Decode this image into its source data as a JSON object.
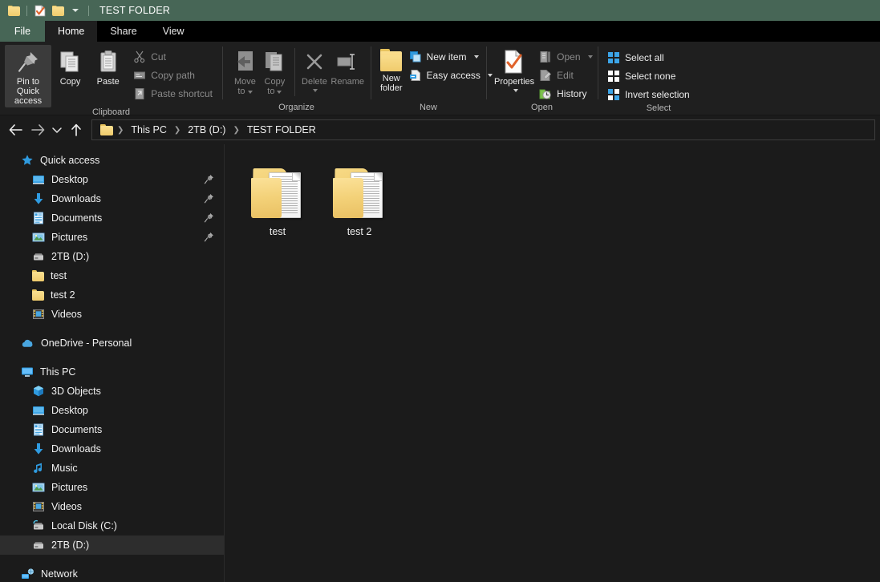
{
  "window": {
    "title": "TEST FOLDER",
    "titlebar_color": "#476656",
    "background_color": "#1b1b1b"
  },
  "quick_access_toolbar": [
    {
      "icon": "folder-icon",
      "name": "properties-folder-icon"
    },
    {
      "icon": "properties-icon",
      "name": "properties-icon"
    },
    {
      "icon": "new-folder-icon",
      "name": "new-folder-icon"
    },
    {
      "icon": "chevron-down-icon",
      "name": "customize-qat-chevron-icon"
    }
  ],
  "tabs": {
    "file": "File",
    "items": [
      {
        "label": "Home",
        "active": true
      },
      {
        "label": "Share",
        "active": false
      },
      {
        "label": "View",
        "active": false
      }
    ]
  },
  "ribbon": {
    "groups": [
      {
        "label": "Clipboard",
        "big_buttons": [
          {
            "label_line1": "Pin to Quick",
            "label_line2": "access",
            "icon": "pin-icon",
            "selected": true,
            "disabled": false
          },
          {
            "label_line1": "Copy",
            "label_line2": "",
            "icon": "copy-icon",
            "selected": false,
            "disabled": false
          },
          {
            "label_line1": "Paste",
            "label_line2": "",
            "icon": "paste-icon",
            "selected": false,
            "disabled": false
          }
        ],
        "small_buttons": [
          {
            "label": "Cut",
            "icon": "scissors-icon",
            "disabled": true
          },
          {
            "label": "Copy path",
            "icon": "copy-path-icon",
            "disabled": true
          },
          {
            "label": "Paste shortcut",
            "icon": "paste-shortcut-icon",
            "disabled": true
          }
        ]
      },
      {
        "label": "Organize",
        "big_buttons": [
          {
            "label_line1": "Move",
            "label_line2": "to",
            "icon": "move-to-icon",
            "has_caret": true,
            "disabled": true
          },
          {
            "label_line1": "Copy",
            "label_line2": "to",
            "icon": "copy-to-icon",
            "has_caret": true,
            "disabled": true
          },
          {
            "label_line1": "Delete",
            "label_line2": "",
            "icon": "delete-icon",
            "has_caret": true,
            "disabled": true
          },
          {
            "label_line1": "Rename",
            "label_line2": "",
            "icon": "rename-icon",
            "has_caret": false,
            "disabled": true
          }
        ],
        "small_buttons": []
      },
      {
        "label": "New",
        "big_buttons": [
          {
            "label_line1": "New",
            "label_line2": "folder",
            "icon": "new-folder-icon",
            "has_caret": false,
            "disabled": false
          }
        ],
        "small_buttons": [
          {
            "label": "New item",
            "icon": "new-item-icon",
            "has_caret": true,
            "disabled": false
          },
          {
            "label": "Easy access",
            "icon": "easy-access-icon",
            "has_caret": true,
            "disabled": false
          }
        ]
      },
      {
        "label": "Open",
        "big_buttons": [
          {
            "label_line1": "Properties",
            "label_line2": "",
            "icon": "properties-icon",
            "has_caret": true,
            "disabled": false
          }
        ],
        "small_buttons": [
          {
            "label": "Open",
            "icon": "open-icon",
            "has_caret": true,
            "disabled": true
          },
          {
            "label": "Edit",
            "icon": "edit-icon",
            "has_caret": false,
            "disabled": true
          },
          {
            "label": "History",
            "icon": "history-icon",
            "has_caret": false,
            "disabled": false
          }
        ]
      },
      {
        "label": "Select",
        "big_buttons": [],
        "small_buttons": [
          {
            "label": "Select all",
            "icon": "select-all-icon",
            "disabled": false
          },
          {
            "label": "Select none",
            "icon": "select-none-icon",
            "disabled": false
          },
          {
            "label": "Invert selection",
            "icon": "invert-selection-icon",
            "disabled": false
          }
        ]
      }
    ]
  },
  "address_bar": {
    "back": "back-arrow-icon",
    "forward": "forward-arrow-icon",
    "recent": "recent-locations-chevron-icon",
    "up": "up-arrow-icon",
    "breadcrumbs": [
      {
        "label": "This PC"
      },
      {
        "label": "2TB (D:)"
      },
      {
        "label": "TEST FOLDER"
      }
    ]
  },
  "sidebar": {
    "sections": [
      {
        "items": [
          {
            "label": "Quick access",
            "icon": "star-icon",
            "indent": 0,
            "pinned": false,
            "selected": false
          },
          {
            "label": "Desktop",
            "icon": "desktop-icon",
            "indent": 1,
            "pinned": true,
            "selected": false
          },
          {
            "label": "Downloads",
            "icon": "downloads-icon",
            "indent": 1,
            "pinned": true,
            "selected": false
          },
          {
            "label": "Documents",
            "icon": "documents-icon",
            "indent": 1,
            "pinned": true,
            "selected": false
          },
          {
            "label": "Pictures",
            "icon": "pictures-icon",
            "indent": 1,
            "pinned": true,
            "selected": false
          },
          {
            "label": "2TB (D:)",
            "icon": "drive-icon",
            "indent": 1,
            "pinned": false,
            "selected": false
          },
          {
            "label": "test",
            "icon": "folder-icon",
            "indent": 1,
            "pinned": false,
            "selected": false
          },
          {
            "label": "test 2",
            "icon": "folder-icon",
            "indent": 1,
            "pinned": false,
            "selected": false
          },
          {
            "label": "Videos",
            "icon": "videos-icon",
            "indent": 1,
            "pinned": false,
            "selected": false
          }
        ]
      },
      {
        "items": [
          {
            "label": "OneDrive - Personal",
            "icon": "onedrive-icon",
            "indent": 0,
            "pinned": false,
            "selected": false
          }
        ]
      },
      {
        "items": [
          {
            "label": "This PC",
            "icon": "this-pc-icon",
            "indent": 0,
            "pinned": false,
            "selected": false
          },
          {
            "label": "3D Objects",
            "icon": "3d-objects-icon",
            "indent": 1,
            "pinned": false,
            "selected": false
          },
          {
            "label": "Desktop",
            "icon": "desktop-icon",
            "indent": 1,
            "pinned": false,
            "selected": false
          },
          {
            "label": "Documents",
            "icon": "documents-icon",
            "indent": 1,
            "pinned": false,
            "selected": false
          },
          {
            "label": "Downloads",
            "icon": "downloads-icon",
            "indent": 1,
            "pinned": false,
            "selected": false
          },
          {
            "label": "Music",
            "icon": "music-icon",
            "indent": 1,
            "pinned": false,
            "selected": false
          },
          {
            "label": "Pictures",
            "icon": "pictures-icon",
            "indent": 1,
            "pinned": false,
            "selected": false
          },
          {
            "label": "Videos",
            "icon": "videos-icon",
            "indent": 1,
            "pinned": false,
            "selected": false
          },
          {
            "label": "Local Disk (C:)",
            "icon": "local-disk-icon",
            "indent": 1,
            "pinned": false,
            "selected": false
          },
          {
            "label": "2TB (D:)",
            "icon": "drive-icon",
            "indent": 1,
            "pinned": false,
            "selected": true
          }
        ]
      },
      {
        "items": [
          {
            "label": "Network",
            "icon": "network-icon",
            "indent": 0,
            "pinned": false,
            "selected": false
          }
        ]
      }
    ]
  },
  "content": {
    "items": [
      {
        "name": "test",
        "icon": "folder-with-document-icon"
      },
      {
        "name": "test 2",
        "icon": "folder-with-document-icon"
      }
    ]
  }
}
